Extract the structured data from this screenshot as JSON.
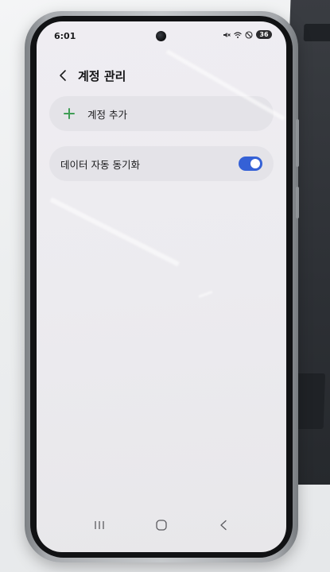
{
  "status_bar": {
    "time": "6:01",
    "battery": "36"
  },
  "header": {
    "title": "계정 관리"
  },
  "add_account": {
    "label": "계정 추가"
  },
  "auto_sync": {
    "label": "데이터 자동 동기화",
    "enabled": true
  },
  "colors": {
    "toggle_on": "#3561d6",
    "plus_accent": "#3f9d55",
    "card_background": "#e4e3e8",
    "screen_background": "#ecebef"
  },
  "icons": [
    "back-chevron-icon",
    "plus-icon",
    "recents-icon",
    "home-icon",
    "back-nav-icon",
    "mute-icon",
    "wifi-icon",
    "do-not-disturb-icon",
    "battery-icon"
  ]
}
